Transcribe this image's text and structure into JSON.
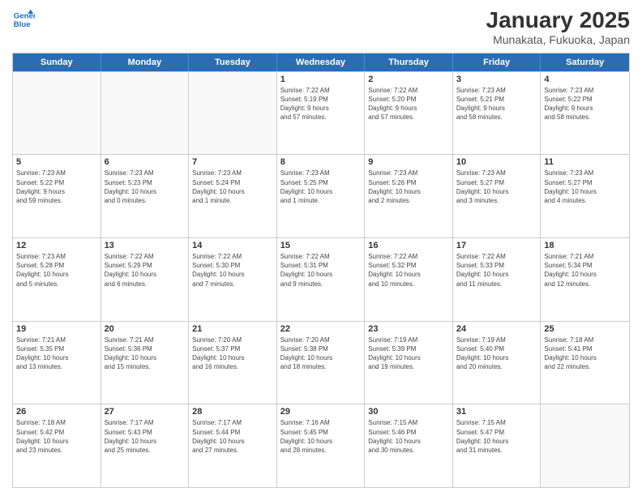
{
  "header": {
    "logo_line1": "General",
    "logo_line2": "Blue",
    "title": "January 2025",
    "subtitle": "Munakata, Fukuoka, Japan"
  },
  "days": [
    "Sunday",
    "Monday",
    "Tuesday",
    "Wednesday",
    "Thursday",
    "Friday",
    "Saturday"
  ],
  "weeks": [
    [
      {
        "day": "",
        "info": ""
      },
      {
        "day": "",
        "info": ""
      },
      {
        "day": "",
        "info": ""
      },
      {
        "day": "1",
        "info": "Sunrise: 7:22 AM\nSunset: 5:19 PM\nDaylight: 9 hours\nand 57 minutes."
      },
      {
        "day": "2",
        "info": "Sunrise: 7:22 AM\nSunset: 5:20 PM\nDaylight: 9 hours\nand 57 minutes."
      },
      {
        "day": "3",
        "info": "Sunrise: 7:23 AM\nSunset: 5:21 PM\nDaylight: 9 hours\nand 58 minutes."
      },
      {
        "day": "4",
        "info": "Sunrise: 7:23 AM\nSunset: 5:22 PM\nDaylight: 9 hours\nand 58 minutes."
      }
    ],
    [
      {
        "day": "5",
        "info": "Sunrise: 7:23 AM\nSunset: 5:22 PM\nDaylight: 9 hours\nand 59 minutes."
      },
      {
        "day": "6",
        "info": "Sunrise: 7:23 AM\nSunset: 5:23 PM\nDaylight: 10 hours\nand 0 minutes."
      },
      {
        "day": "7",
        "info": "Sunrise: 7:23 AM\nSunset: 5:24 PM\nDaylight: 10 hours\nand 1 minute."
      },
      {
        "day": "8",
        "info": "Sunrise: 7:23 AM\nSunset: 5:25 PM\nDaylight: 10 hours\nand 1 minute."
      },
      {
        "day": "9",
        "info": "Sunrise: 7:23 AM\nSunset: 5:26 PM\nDaylight: 10 hours\nand 2 minutes."
      },
      {
        "day": "10",
        "info": "Sunrise: 7:23 AM\nSunset: 5:27 PM\nDaylight: 10 hours\nand 3 minutes."
      },
      {
        "day": "11",
        "info": "Sunrise: 7:23 AM\nSunset: 5:27 PM\nDaylight: 10 hours\nand 4 minutes."
      }
    ],
    [
      {
        "day": "12",
        "info": "Sunrise: 7:23 AM\nSunset: 5:28 PM\nDaylight: 10 hours\nand 5 minutes."
      },
      {
        "day": "13",
        "info": "Sunrise: 7:22 AM\nSunset: 5:29 PM\nDaylight: 10 hours\nand 6 minutes."
      },
      {
        "day": "14",
        "info": "Sunrise: 7:22 AM\nSunset: 5:30 PM\nDaylight: 10 hours\nand 7 minutes."
      },
      {
        "day": "15",
        "info": "Sunrise: 7:22 AM\nSunset: 5:31 PM\nDaylight: 10 hours\nand 9 minutes."
      },
      {
        "day": "16",
        "info": "Sunrise: 7:22 AM\nSunset: 5:32 PM\nDaylight: 10 hours\nand 10 minutes."
      },
      {
        "day": "17",
        "info": "Sunrise: 7:22 AM\nSunset: 5:33 PM\nDaylight: 10 hours\nand 11 minutes."
      },
      {
        "day": "18",
        "info": "Sunrise: 7:21 AM\nSunset: 5:34 PM\nDaylight: 10 hours\nand 12 minutes."
      }
    ],
    [
      {
        "day": "19",
        "info": "Sunrise: 7:21 AM\nSunset: 5:35 PM\nDaylight: 10 hours\nand 13 minutes."
      },
      {
        "day": "20",
        "info": "Sunrise: 7:21 AM\nSunset: 5:36 PM\nDaylight: 10 hours\nand 15 minutes."
      },
      {
        "day": "21",
        "info": "Sunrise: 7:20 AM\nSunset: 5:37 PM\nDaylight: 10 hours\nand 16 minutes."
      },
      {
        "day": "22",
        "info": "Sunrise: 7:20 AM\nSunset: 5:38 PM\nDaylight: 10 hours\nand 18 minutes."
      },
      {
        "day": "23",
        "info": "Sunrise: 7:19 AM\nSunset: 5:39 PM\nDaylight: 10 hours\nand 19 minutes."
      },
      {
        "day": "24",
        "info": "Sunrise: 7:19 AM\nSunset: 5:40 PM\nDaylight: 10 hours\nand 20 minutes."
      },
      {
        "day": "25",
        "info": "Sunrise: 7:18 AM\nSunset: 5:41 PM\nDaylight: 10 hours\nand 22 minutes."
      }
    ],
    [
      {
        "day": "26",
        "info": "Sunrise: 7:18 AM\nSunset: 5:42 PM\nDaylight: 10 hours\nand 23 minutes."
      },
      {
        "day": "27",
        "info": "Sunrise: 7:17 AM\nSunset: 5:43 PM\nDaylight: 10 hours\nand 25 minutes."
      },
      {
        "day": "28",
        "info": "Sunrise: 7:17 AM\nSunset: 5:44 PM\nDaylight: 10 hours\nand 27 minutes."
      },
      {
        "day": "29",
        "info": "Sunrise: 7:16 AM\nSunset: 5:45 PM\nDaylight: 10 hours\nand 28 minutes."
      },
      {
        "day": "30",
        "info": "Sunrise: 7:15 AM\nSunset: 5:46 PM\nDaylight: 10 hours\nand 30 minutes."
      },
      {
        "day": "31",
        "info": "Sunrise: 7:15 AM\nSunset: 5:47 PM\nDaylight: 10 hours\nand 31 minutes."
      },
      {
        "day": "",
        "info": ""
      }
    ]
  ]
}
